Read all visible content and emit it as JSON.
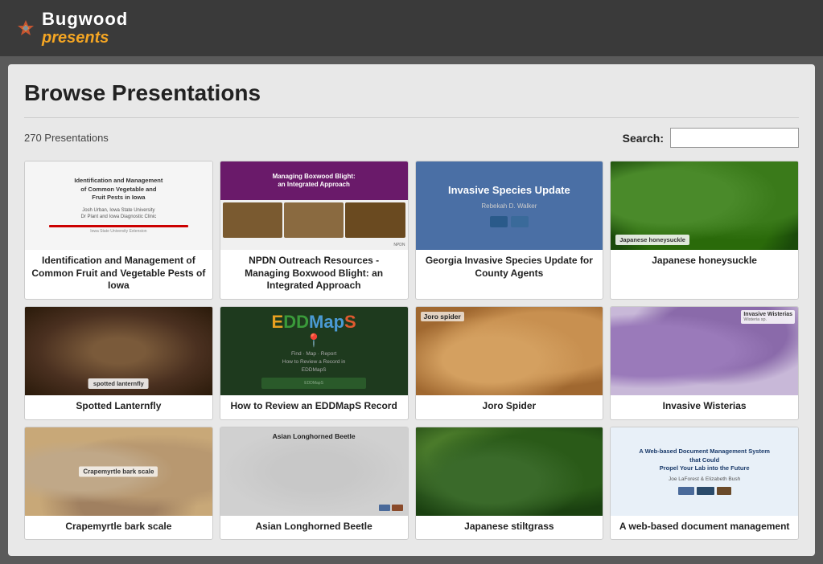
{
  "header": {
    "logo_bugwood": "Bugwood",
    "logo_presents": "presents"
  },
  "browse": {
    "title": "Browse Presentations",
    "count": "270 Presentations",
    "search_label": "Search:",
    "search_placeholder": ""
  },
  "cards": [
    {
      "id": "iowa-pests",
      "caption": "Identification and Management of Common Fruit and Vegetable Pests of Iowa",
      "thumb_type": "iowa",
      "thumb_lines": [
        "Identification and Management",
        "of Common Vegetable and",
        "Fruit Pests in Iowa"
      ]
    },
    {
      "id": "boxwood-blight",
      "caption": "NPDN Outreach Resources - Managing Boxwood Blight: an Integrated Approach",
      "thumb_type": "boxwood",
      "thumb_title": "Managing Boxwood Blight: an Integrated Approach"
    },
    {
      "id": "georgia-invasive",
      "caption": "Georgia Invasive Species Update for County Agents",
      "thumb_type": "invasive",
      "thumb_title": "Invasive Species Update",
      "thumb_subtitle": "Rebekah D. Walker"
    },
    {
      "id": "japanese-honeysuckle",
      "caption": "Japanese honeysuckle",
      "thumb_type": "honeysuckle",
      "thumb_label": "Japanese honeysuckle"
    },
    {
      "id": "spotted-lanternfly",
      "caption": "Spotted Lanternfly",
      "thumb_type": "lanternfly",
      "thumb_label": "spotted lanternfly"
    },
    {
      "id": "eddmaps",
      "caption": "How to Review an EDDMapS Record",
      "thumb_type": "eddmaps",
      "thumb_title": "How to Review a Record in EDDMapS"
    },
    {
      "id": "joro-spider",
      "caption": "Joro Spider",
      "thumb_type": "joro",
      "thumb_label": "Joro spider"
    },
    {
      "id": "invasive-wisterias",
      "caption": "Invasive Wisterias",
      "thumb_type": "wisteria",
      "thumb_label": "Invasive Wisterias"
    },
    {
      "id": "crapemyrtle",
      "caption": "Crapemyrtle bark scale",
      "thumb_type": "crapemyrtle",
      "thumb_label": "Crapemyrtle bark scale"
    },
    {
      "id": "asian-longhorned",
      "caption": "Asian Longhorned Beetle",
      "thumb_type": "longhorned",
      "thumb_label": "Asian Longhorned Beetle"
    },
    {
      "id": "japanese-stiltgrass",
      "caption": "Japanese stiltgrass",
      "thumb_type": "stiltgrass",
      "thumb_label": ""
    },
    {
      "id": "web-based",
      "caption": "A web-based document management",
      "thumb_type": "webased",
      "thumb_title": "A Web-based Document Management System that Could Propel Your Lab into the Future",
      "thumb_author": "Joe LaForest & Elizabeth Bush"
    }
  ]
}
